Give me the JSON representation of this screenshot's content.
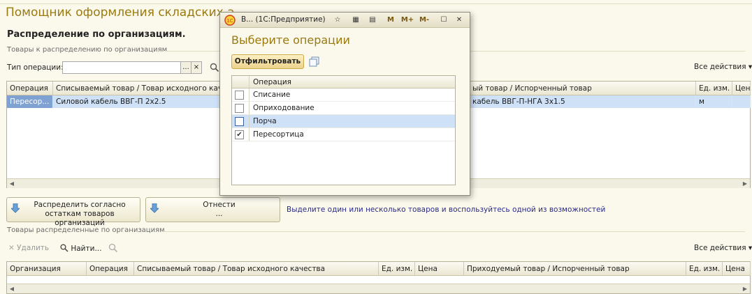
{
  "page": {
    "title": "Помощник оформления складских а",
    "section_title": "Распределение по организациям."
  },
  "top_group": {
    "label": "Товары к распределению по организациям",
    "op_type_label": "Тип операции:",
    "op_type_value": "",
    "ellipsis": "...",
    "clear": "×",
    "all_actions": "Все действия"
  },
  "top_grid": {
    "columns": [
      "Операция",
      "Списываемый товар / Товар исходного каче",
      "ый товар / Испорченный товар",
      "Ед. изм.",
      "Цен"
    ],
    "rows": [
      {
        "operation": "Пересор...",
        "source": "Силовой кабель ВВГ-П 2х2.5",
        "target": "кабель ВВГ-П-НГА 3х1.5",
        "unit": "м",
        "price": ""
      }
    ]
  },
  "buttons": {
    "distribute_line1": "Распределить согласно",
    "distribute_line2": "остаткам товаров организаций",
    "assign_line1": "Отнести",
    "assign_line2": "...",
    "hint": "Выделите один или несколько товаров и воспользуйтесь одной из возможностей"
  },
  "bottom_group": {
    "label": "Товары распределенные по организациям",
    "delete": "Удалить",
    "find": "Найти...",
    "all_actions": "Все действия"
  },
  "bottom_grid": {
    "columns": [
      "Организация",
      "Операция",
      "Списываемый товар / Товар исходного качества",
      "Ед. изм.",
      "Цена",
      "Приходуемый товар / Испорченный товар",
      "Ед. изм.",
      "Цена"
    ]
  },
  "modal": {
    "window_title": "В...  (1С:Предприятие)",
    "tb_m": "M",
    "tb_mplus": "M+",
    "tb_mminus": "M-",
    "heading": "Выберите операции",
    "filter_button": "Отфильтровать",
    "column_header": "Операция",
    "options": [
      {
        "label": "Списание",
        "checked": false,
        "selected": false
      },
      {
        "label": "Оприходование",
        "checked": false,
        "selected": false
      },
      {
        "label": "Порча",
        "checked": false,
        "selected": true
      },
      {
        "label": "Пересортица",
        "checked": true,
        "selected": false
      }
    ]
  },
  "colors": {
    "accent_title": "#9a7a10",
    "selection": "#cfe1f7",
    "active_cell": "#7fa2d2",
    "background": "#fbf9ec"
  }
}
